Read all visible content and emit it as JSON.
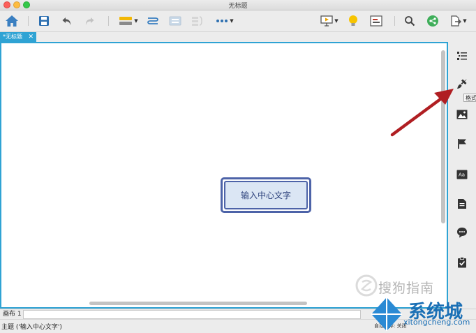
{
  "window": {
    "title": "无标题"
  },
  "toolbar": {
    "items": [
      "home",
      "save",
      "undo",
      "redo",
      "structure",
      "relationship",
      "boundary",
      "summary",
      "more",
      "presentation",
      "idea",
      "layout",
      "search",
      "share",
      "export"
    ]
  },
  "document_tab": {
    "label": "*无标题",
    "close_symbol": "✕"
  },
  "canvas": {
    "central_topic": "输入中心文字"
  },
  "side_panel": {
    "items": [
      "outline",
      "format",
      "image",
      "marker",
      "text",
      "notes",
      "comments",
      "task"
    ],
    "tooltip": "格式"
  },
  "sheet_bar": {
    "sheet_label": "画布 1"
  },
  "status_bar": {
    "left_text": "主题 ('输入中心文字')",
    "right_text": "自动保存: 关闭"
  },
  "watermarks": {
    "sogou": "搜狗指南",
    "xitongcheng": "系统城",
    "xitongcheng_url": "xitongcheng.com"
  },
  "colors": {
    "accent": "#2fa3d4",
    "topic_border": "#4d63a8",
    "topic_fill": "#dbe6f4",
    "annotation_arrow": "#b01e22"
  }
}
